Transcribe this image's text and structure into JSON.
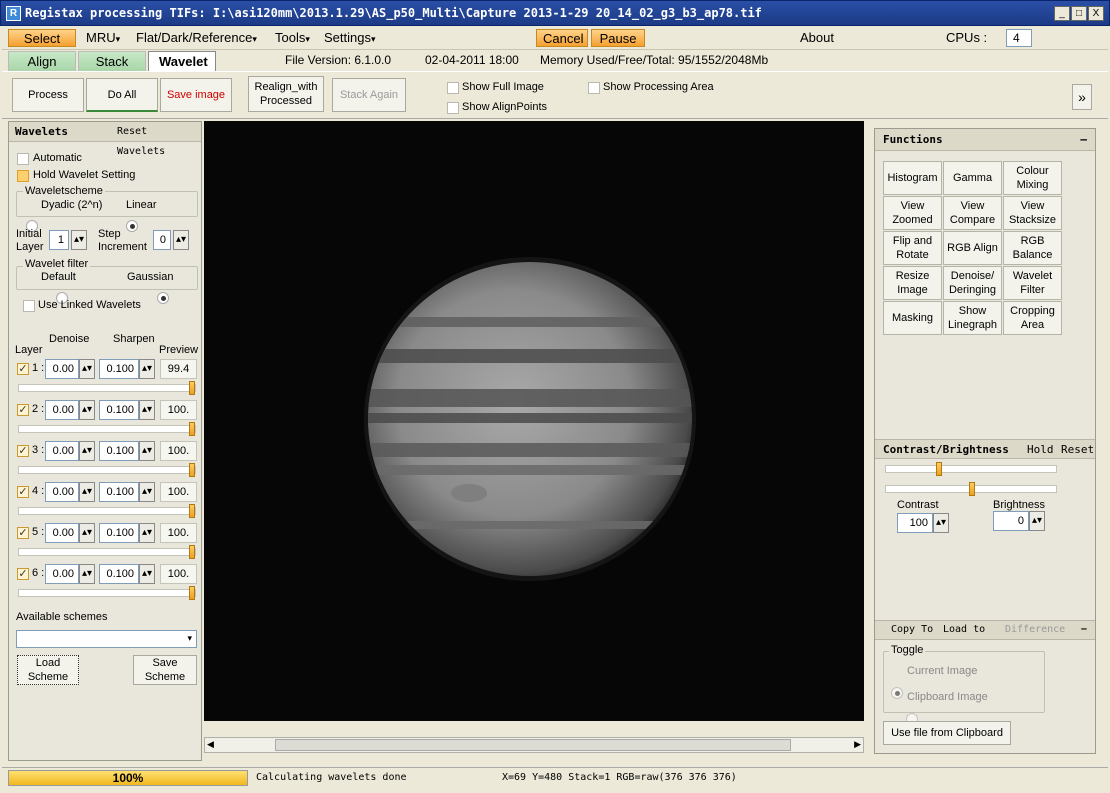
{
  "window": {
    "title": "Registax processing TIFs: I:\\asi120mm\\2013.1.29\\AS_p50_Multi\\Capture 2013-1-29 20_14_02_g3_b3_ap78.tif",
    "icon": "R",
    "min": "_",
    "max": "□",
    "close": "X"
  },
  "menu": {
    "select": "Select",
    "mru": "MRU",
    "flat": "Flat/Dark/Reference",
    "tools": "Tools",
    "settings": "Settings",
    "cancel": "Cancel",
    "pause": "Pause",
    "about": "About",
    "cpus_label": "CPUs :",
    "cpus_value": "4",
    "arrow": "▾"
  },
  "tabs": {
    "align": "Align",
    "stack": "Stack",
    "wavelet": "Wavelet",
    "file_version": "File Version: 6.1.0.0",
    "date": "02-04-2011 18:00",
    "memory": "Memory Used/Free/Total: 95/1552/2048Mb"
  },
  "toolbar": {
    "process": "Process",
    "do_all": "Do All",
    "save_image": "Save image",
    "realign": "Realign_with Processed",
    "stack_again": "Stack Again",
    "show_full_image": "Show Full Image",
    "show_alignpoints": "Show AlignPoints",
    "show_processing_area": "Show Processing Area",
    "expand": "»"
  },
  "wavelets": {
    "title": "Wavelets",
    "reset": "Reset Wavelets",
    "automatic": "Automatic",
    "hold_setting": "Hold Wavelet Setting",
    "scheme_label": "Waveletscheme",
    "dyadic": "Dyadic (2^n)",
    "linear": "Linear",
    "initial_layer_label": "Initial Layer",
    "initial_layer_value": "1",
    "step_label": "Step Increment",
    "step_value": "0",
    "filter_label": "Wavelet filter",
    "default": "Default",
    "gaussian": "Gaussian",
    "use_linked": "Use Linked Wavelets",
    "col_denoise": "Denoise",
    "col_sharpen": "Sharpen",
    "col_layer": "Layer",
    "col_preview": "Preview",
    "layers": [
      {
        "label": "1 :",
        "denoise": "0.00",
        "sharpen": "0.100",
        "preview": "99.4",
        "level": 1.0
      },
      {
        "label": "2 :",
        "denoise": "0.00",
        "sharpen": "0.100",
        "preview": "100.",
        "level": 1.0
      },
      {
        "label": "3 :",
        "denoise": "0.00",
        "sharpen": "0.100",
        "preview": "100.",
        "level": 1.0
      },
      {
        "label": "4 :",
        "denoise": "0.00",
        "sharpen": "0.100",
        "preview": "100.",
        "level": 1.0
      },
      {
        "label": "5 :",
        "denoise": "0.00",
        "sharpen": "0.100",
        "preview": "100.",
        "level": 1.0
      },
      {
        "label": "6 :",
        "denoise": "0.00",
        "sharpen": "0.100",
        "preview": "100.",
        "level": 1.0
      }
    ],
    "available_schemes": "Available schemes",
    "load_scheme": "Load Scheme",
    "save_scheme": "Save Scheme"
  },
  "functions": {
    "title": "Functions",
    "collapse": "–",
    "buttons": [
      "Histogram",
      "Gamma",
      "Colour Mixing",
      "View Zoomed",
      "View Compare",
      "View Stacksize",
      "Flip and Rotate",
      "RGB Align",
      "RGB Balance",
      "Resize Image",
      "Denoise/ Deringing",
      "Wavelet Filter",
      "Masking",
      "Show Linegraph",
      "Cropping Area"
    ]
  },
  "contrast": {
    "title": "Contrast/Brightness",
    "hold": "Hold",
    "reset": "Reset",
    "contrast_label": "Contrast",
    "contrast_value": "100",
    "brightness_label": "Brightness",
    "brightness_value": "0",
    "contrast_level": 0.3,
    "brightness_level": 0.5
  },
  "copy": {
    "copy_to": "Copy To",
    "load_to": "Load to",
    "difference": "Difference",
    "collapse": "–",
    "toggle": "Toggle",
    "current_image": "Current Image",
    "clipboard_image": "Clipboard Image",
    "use_clipboard": "Use file from Clipboard"
  },
  "status": {
    "progress": "100%",
    "message": "Calculating wavelets done",
    "coords": "X=69 Y=480 Stack=1 RGB=raw(376 376 376)"
  },
  "colors": {
    "accent_orange": "#f5a030",
    "tab_green": "#a9d6a9",
    "title_blue": "#1c3a86"
  }
}
